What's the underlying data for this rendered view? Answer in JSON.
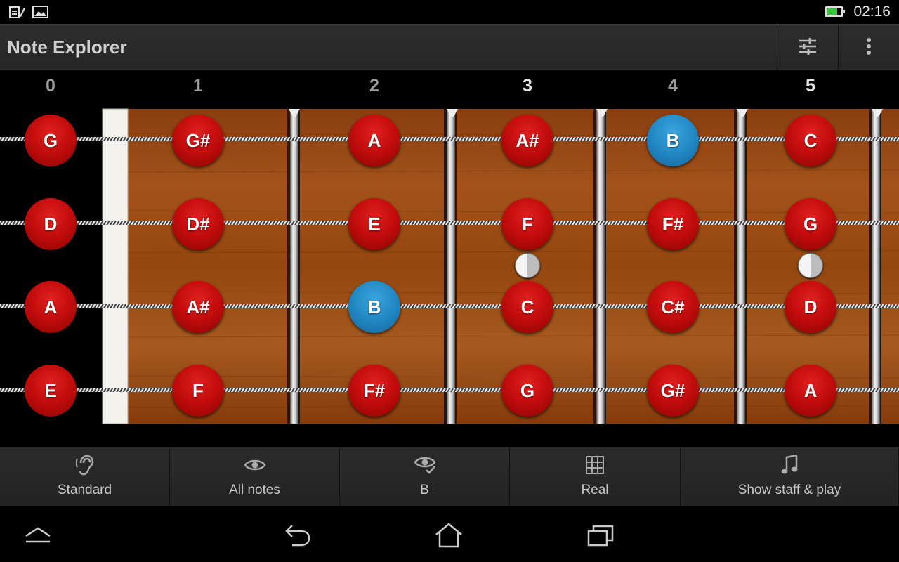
{
  "status_bar": {
    "time": "02:16",
    "battery_level": 0.75,
    "notification_icons": [
      "clipboard-pen-icon",
      "image-icon"
    ]
  },
  "app_bar": {
    "title": "Note Explorer",
    "actions": [
      "tune-settings-icon",
      "overflow-menu-icon"
    ]
  },
  "fret_numbers": [
    "0",
    "1",
    "2",
    "3",
    "4",
    "5"
  ],
  "strings": [
    {
      "open": "G",
      "notes": [
        "G",
        "G#",
        "A",
        "A#",
        "B",
        "C"
      ],
      "highlight": [
        false,
        false,
        false,
        false,
        true,
        false
      ]
    },
    {
      "open": "D",
      "notes": [
        "D",
        "D#",
        "E",
        "F",
        "F#",
        "G"
      ],
      "highlight": [
        false,
        false,
        false,
        false,
        false,
        false
      ]
    },
    {
      "open": "A",
      "notes": [
        "A",
        "A#",
        "B",
        "C",
        "C#",
        "D"
      ],
      "highlight": [
        false,
        false,
        true,
        false,
        false,
        false
      ]
    },
    {
      "open": "E",
      "notes": [
        "E",
        "F",
        "F#",
        "G",
        "G#",
        "A"
      ],
      "highlight": [
        false,
        false,
        false,
        false,
        false,
        false
      ]
    }
  ],
  "colors": {
    "note_default": "#c40d0d",
    "note_highlight": "#2188c4",
    "fretboard_wood": "#9a4a14"
  },
  "toolbar": [
    {
      "label": "Standard",
      "icon": "ear-icon"
    },
    {
      "label": "All notes",
      "icon": "eye-icon"
    },
    {
      "label": "B",
      "icon": "eye-check-icon"
    },
    {
      "label": "Real",
      "icon": "grid-icon"
    },
    {
      "label": "Show staff & play",
      "icon": "music-note-icon"
    }
  ],
  "nav_bar": [
    "menu-up-icon",
    "back-icon",
    "home-icon",
    "recent-apps-icon"
  ]
}
